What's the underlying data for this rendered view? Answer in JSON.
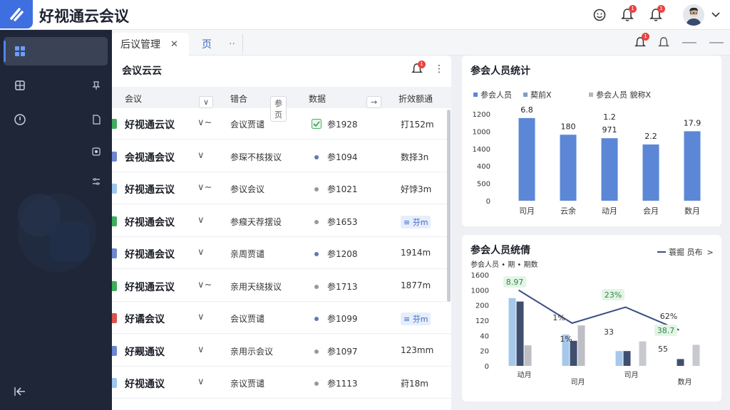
{
  "app": {
    "title": "好视通云会议"
  },
  "topbar": {
    "badge_bell1": "1",
    "badge_bell2": "1"
  },
  "tabs": [
    {
      "label": "后议管理"
    },
    {
      "label": "页"
    },
    {
      "label": "··"
    }
  ],
  "tabbar": {
    "badge": "1"
  },
  "list_panel": {
    "title": "会议云云",
    "badge": "1",
    "headers": {
      "col1": "会议",
      "col2": "错合",
      "col2_chip": "参页",
      "col3": "数据",
      "col3_chip": "→",
      "col4": "折效额通"
    },
    "rows": [
      {
        "name": "好视通云议",
        "chevron": "∨~",
        "col2": "会议贾谴",
        "col3": "参1928",
        "col4": "打152m",
        "col4_tag": "",
        "mark_color": "#3fae5c",
        "icon": "check"
      },
      {
        "name": "会视通会议",
        "chevron": "∨",
        "col2": "参琛不核拨议",
        "col3": "参1094",
        "col4": "数择3n",
        "col4_tag": "",
        "mark_color": "#6b88d0",
        "icon": "dot-blue"
      },
      {
        "name": "好视通云议",
        "chevron": "∨~",
        "col2": "参议会议",
        "col3": "参1021",
        "col4": "好饽3m",
        "col4_tag": "",
        "mark_color": "#9ec7ef",
        "icon": "dot-gray"
      },
      {
        "name": "好视通会议",
        "chevron": "∨",
        "col2": "参瘊天荐摆设",
        "col3": "参1653",
        "col4": "",
        "col4_tag": "≡ 芬m",
        "mark_color": "#3fae5c",
        "icon": "dot-gray"
      },
      {
        "name": "好视通会议",
        "chevron": "∨",
        "col2": "亲周贾谴",
        "col3": "参1208",
        "col4": "1914m",
        "col4_tag": "",
        "mark_color": "#6b88d0",
        "icon": "dot-blue"
      },
      {
        "name": "好视通云议",
        "chevron": "∨~",
        "col2": "亲用天绕拨议",
        "col3": "参1713",
        "col4": "1877m",
        "col4_tag": "",
        "mark_color": "#3fae5c",
        "icon": "dot-gray"
      },
      {
        "name": "好谲会议",
        "chevron": "∨",
        "col2": "会议贾谴",
        "col3": "参1099",
        "col4": "",
        "col4_tag": "≡ 芬m",
        "mark_color": "#d9534f",
        "icon": "dot-blue"
      },
      {
        "name": "好觋通议",
        "chevron": "∨",
        "col2": "亲用示会议",
        "col3": "参1097",
        "col4": "123mm",
        "col4_tag": "",
        "mark_color": "#6b88d0",
        "icon": "dot-gray"
      },
      {
        "name": "好视通议",
        "chevron": "∨",
        "col2": "亲议贾谴",
        "col3": "参1113",
        "col4": "荮18m",
        "col4_tag": "",
        "mark_color": "#9ec7ef",
        "icon": "dot-gray"
      }
    ]
  },
  "bar_panel": {
    "title": "参会人员统计",
    "legend": [
      {
        "label": "参会人员",
        "color": "#5b87d6"
      },
      {
        "label": "葜前X",
        "color": "#7f9bc9"
      },
      {
        "label": "参会人员 貌称X",
        "color": "#b5b8bf"
      }
    ],
    "chart_data": {
      "type": "bar",
      "categories": [
        "司月",
        "云余",
        "动月",
        "会月",
        "数月"
      ],
      "values": [
        1190,
        950,
        900,
        810,
        1000
      ],
      "data_labels": [
        "6.8",
        "180",
        "1.2 971",
        "2.2",
        "17.9"
      ],
      "ytick_labels": [
        "0",
        "500",
        "400",
        "1400",
        "1000",
        "1200"
      ],
      "ylim": [
        0,
        1250
      ],
      "color": "#5b87d6"
    }
  },
  "combo_panel": {
    "title": "参会人员统倩",
    "subtitle": "参会人员 • 期 • 期数",
    "legend_label": "蓑掘 员布",
    "legend_arrow": ">",
    "chart_data": {
      "type": "bar",
      "categories": [
        "动月",
        "司月",
        "司月",
        "数月"
      ],
      "series": [
        {
          "values": [
            1190,
            550,
            260,
            0
          ],
          "color": "#a6c8ea"
        },
        {
          "values": [
            1130,
            440,
            260,
            120
          ],
          "color": "#3f4f70"
        },
        {
          "values": [
            360,
            710,
            0,
            0
          ],
          "color": "#bdbfc4"
        },
        {
          "values": [
            0,
            0,
            430,
            370
          ],
          "color": "#c7c9ce"
        }
      ],
      "line_values": [
        1330,
        750,
        1030,
        630
      ],
      "ytick_labels": [
        "0",
        "20",
        "40",
        "120",
        "200",
        "1000",
        "1600"
      ],
      "ylim": [
        0,
        1600
      ],
      "annotations": [
        "8.97",
        "1%",
        "23%",
        "1%",
        "33",
        "62%",
        "38.7",
        "55"
      ]
    }
  }
}
